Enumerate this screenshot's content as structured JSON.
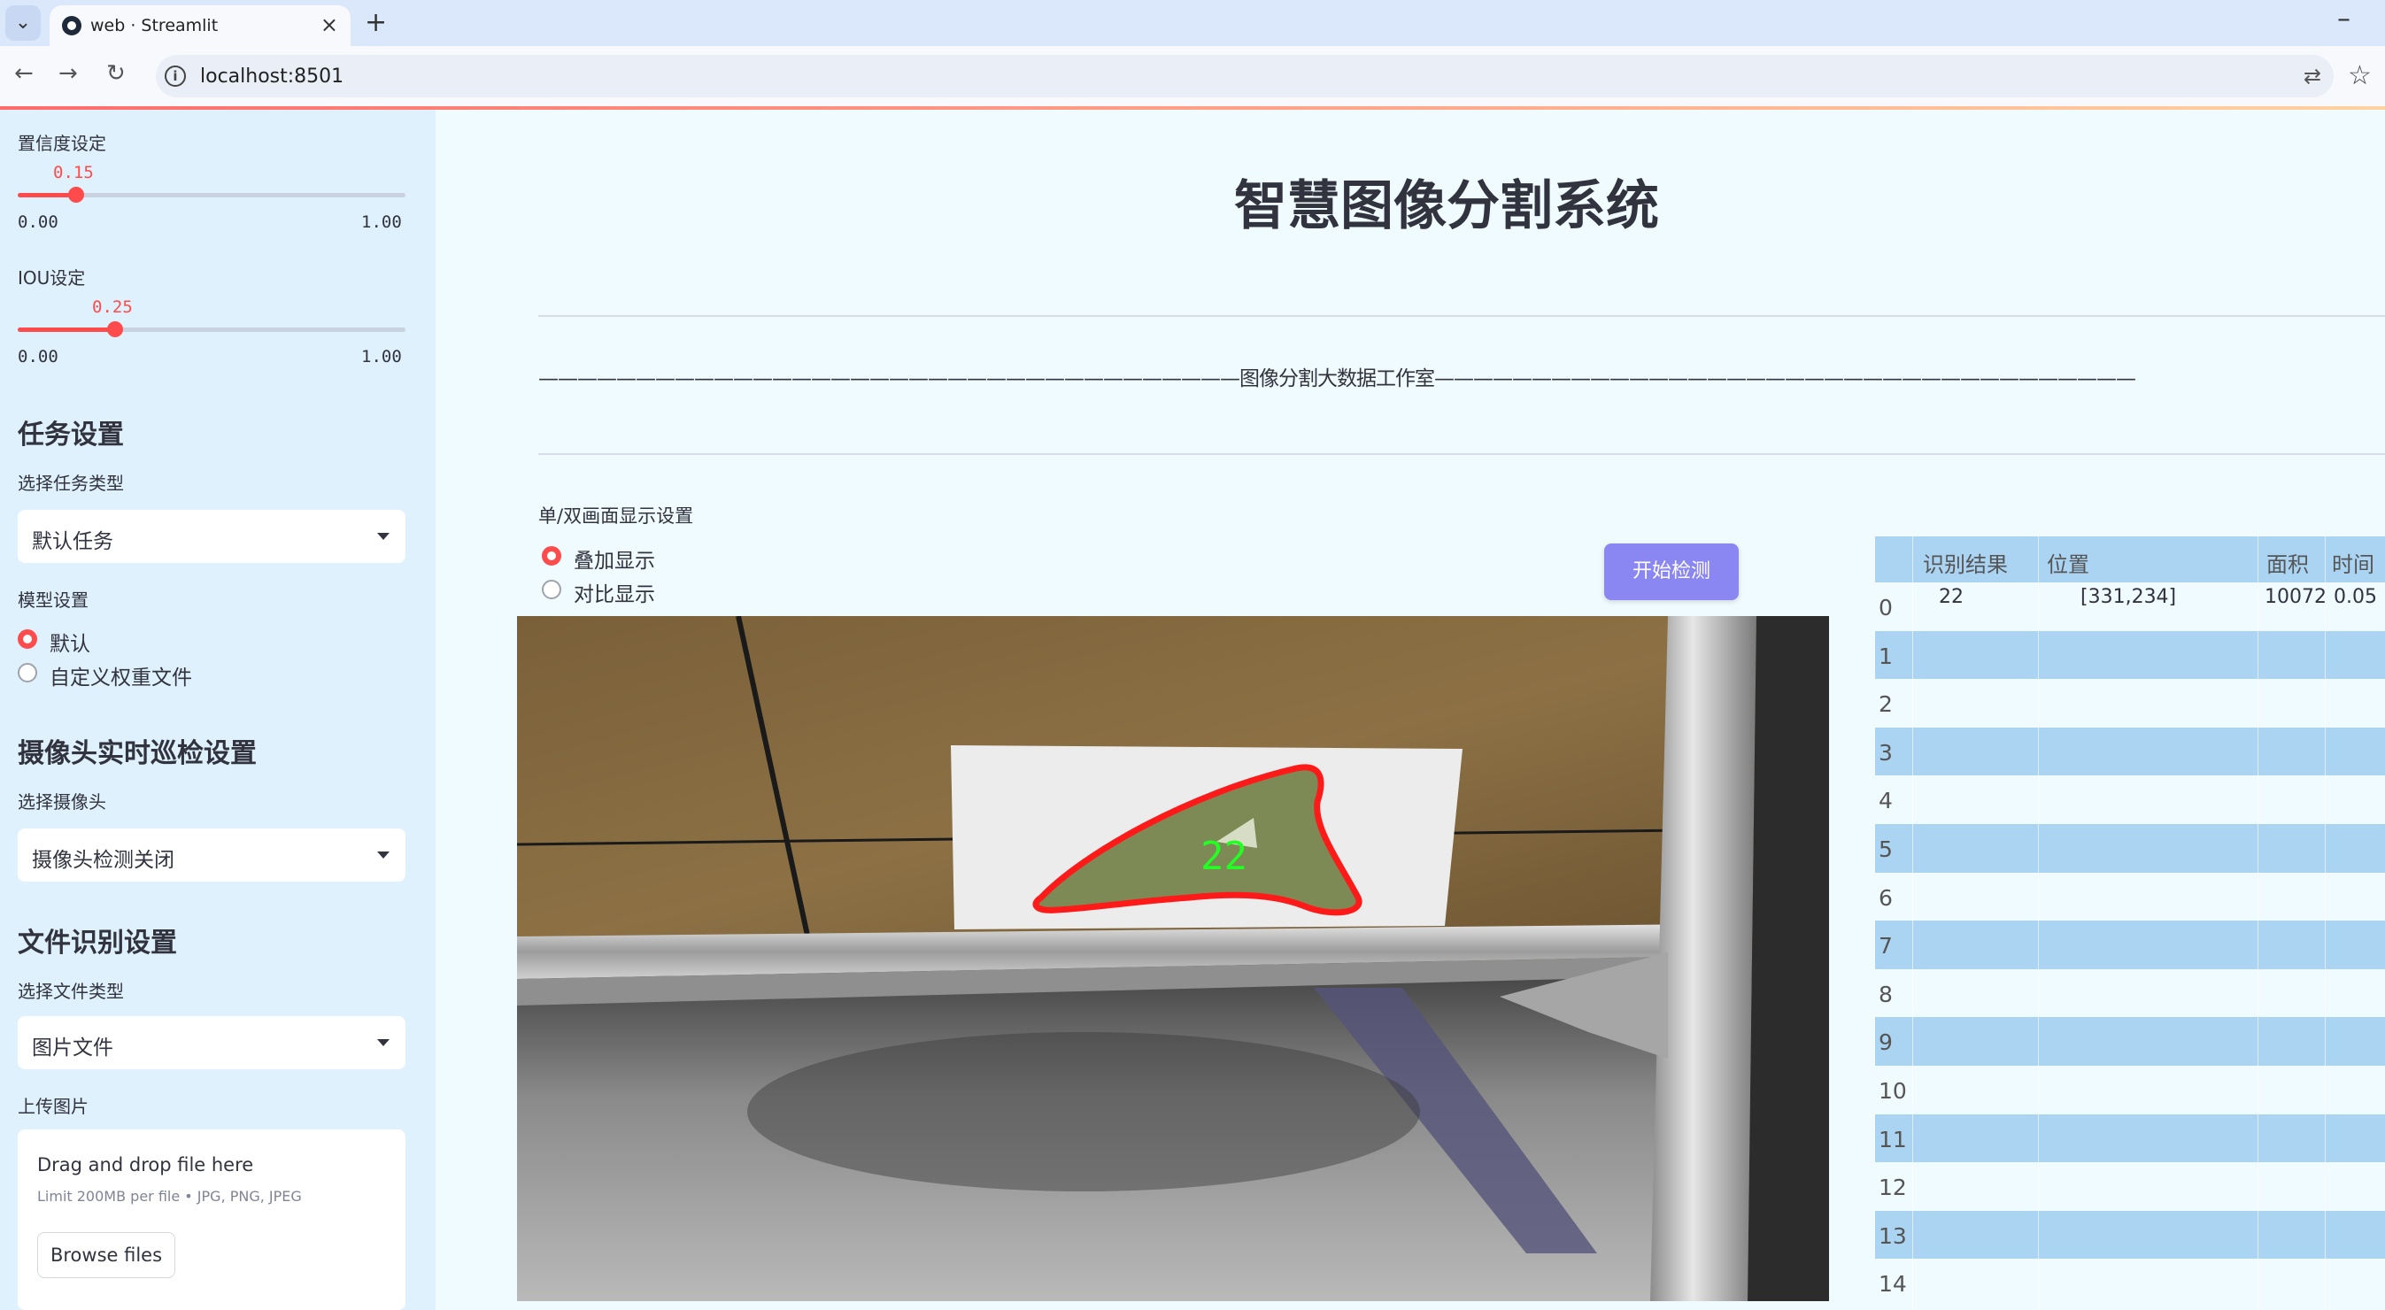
{
  "browser": {
    "tab_title": "web · Streamlit",
    "url": "localhost:8501"
  },
  "sidebar": {
    "confidence": {
      "label": "置信度设定",
      "value": "0.15",
      "min": "0.00",
      "max": "1.00",
      "fraction": 0.15
    },
    "iou": {
      "label": "IOU设定",
      "value": "0.25",
      "min": "0.00",
      "max": "1.00",
      "fraction": 0.25
    },
    "task_section": "任务设置",
    "task_type_label": "选择任务类型",
    "task_type_value": "默认任务",
    "model_label": "模型设置",
    "model_options": [
      "默认",
      "自定义权重文件"
    ],
    "model_selected": 0,
    "camera_section": "摄像头实时巡检设置",
    "camera_label": "选择摄像头",
    "camera_value": "摄像头检测关闭",
    "file_section": "文件识别设置",
    "file_type_label": "选择文件类型",
    "file_type_value": "图片文件",
    "upload_label": "上传图片",
    "upload_title": "Drag and drop file here",
    "upload_limit": "Limit 200MB per file • JPG, PNG, JPEG",
    "browse_label": "Browse files"
  },
  "main": {
    "title": "智慧图像分割系统",
    "studio_line": "————————————————————————————————————图像分割大数据工作室————————————————————————————————————",
    "display_mode_label": "单/双画面显示设置",
    "display_options": [
      "叠加显示",
      "对比显示"
    ],
    "display_selected": 0,
    "start_button": "开始检测",
    "detection_label": "22"
  },
  "results_table": {
    "columns": [
      "识别结果",
      "位置",
      "面积",
      "时间"
    ],
    "row_indices": [
      "0",
      "1",
      "2",
      "3",
      "4",
      "5",
      "6",
      "7",
      "8",
      "9",
      "10",
      "11",
      "12",
      "13",
      "14"
    ],
    "rows": [
      {
        "result": "22",
        "position": "[331,234]",
        "area": "10072",
        "time": "0.05"
      }
    ]
  },
  "colors": {
    "accent": "#ff4b4b",
    "button": "#8b87f2",
    "sidebar_bg": "#dff1fc",
    "main_bg": "#f0fbff",
    "table_stripe": "#aad4f2"
  }
}
